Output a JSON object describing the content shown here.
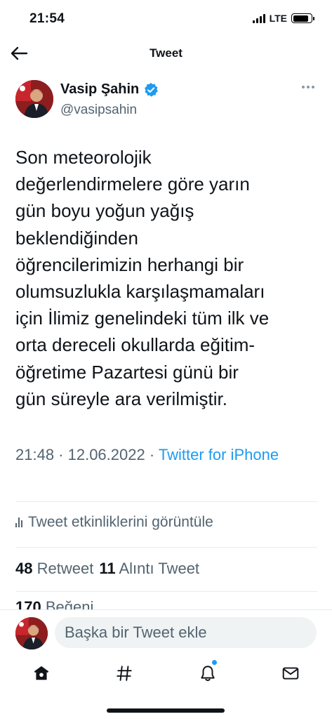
{
  "status_bar": {
    "time": "21:54",
    "network": "LTE",
    "battery_level": 0.85
  },
  "nav": {
    "title": "Tweet",
    "back_icon": "arrow-left-icon"
  },
  "author": {
    "name": "Vasip Şahin",
    "handle": "@vasipsahin",
    "verified": true,
    "verified_color": "#1d9bf0"
  },
  "tweet": {
    "text": "Son meteorolojik\ndeğerlendirmelere göre yarın\ngün boyu yoğun yağış\nbeklendiğinden\nöğrencilerimizin  herhangi bir\nolumsuzlukla karşılaşmamaları\niçin İlimiz genelindeki tüm ilk ve\norta dereceli okullarda eğitim-\nöğretime Pazartesi günü bir\ngün süreyle ara verilmiştir.",
    "timestamp": "21:48 · 12.06.2022 · ",
    "source": "Twitter for iPhone"
  },
  "activity": {
    "label": "Tweet etkinliklerini görüntüle"
  },
  "stats": {
    "retweets_count": "48",
    "retweets_label": "Retweet",
    "quotes_count": "11",
    "quotes_label": "Alıntı Tweet",
    "likes_count": "170",
    "likes_label": "Beğeni"
  },
  "reply": {
    "placeholder": "Başka bir Tweet ekle"
  },
  "tabs": [
    {
      "name": "home-icon"
    },
    {
      "name": "hashtag-icon"
    },
    {
      "name": "bell-icon",
      "has_badge": true
    },
    {
      "name": "mail-icon"
    }
  ],
  "colors": {
    "accent": "#1d9bf0",
    "text": "#0f1419",
    "secondary": "#536471"
  }
}
